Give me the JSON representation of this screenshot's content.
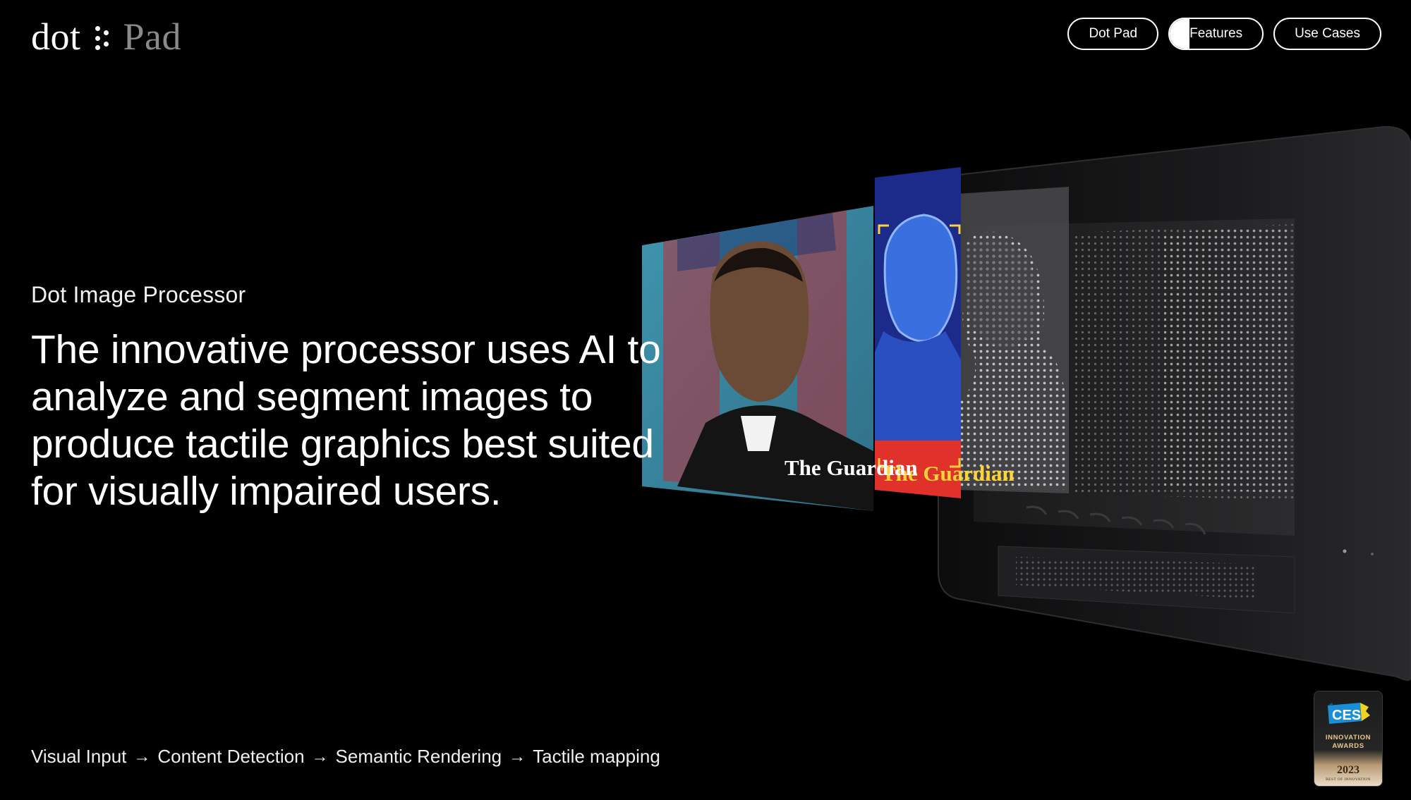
{
  "header": {
    "logo": {
      "word_left": "dot",
      "word_right": "Pad",
      "icon": "braille-dots-icon"
    },
    "nav": [
      {
        "label": "Dot Pad",
        "active": false
      },
      {
        "label": "Features",
        "active": true
      },
      {
        "label": "Use Cases",
        "active": false
      }
    ]
  },
  "hero": {
    "eyebrow": "Dot Image Processor",
    "headline": "The innovative processor uses AI to analyze and segment images to produce tactile graphics best suited for visually impaired users."
  },
  "pipeline": {
    "steps": [
      "Visual Input",
      "Content Detection",
      "Semantic Rendering",
      "Tactile mapping"
    ],
    "separator": "→"
  },
  "visual": {
    "panel_1_caption": "The Guardian",
    "panel_2_caption": "The Guardian",
    "colors": {
      "panel_1_bg": "#3b8aa3",
      "panel_2_bg": "#1c2a8a",
      "panel_2_accent": "#e0312b",
      "device_body": "#1c1c1e"
    }
  },
  "badge": {
    "brand": "CES",
    "line1": "INNOVATION",
    "line2": "AWARDS",
    "year": "2023",
    "subtitle": "BEST OF INNOVATION"
  },
  "colors": {
    "background": "#000000",
    "text": "#ffffff",
    "logo_secondary": "#8a8a8a"
  }
}
